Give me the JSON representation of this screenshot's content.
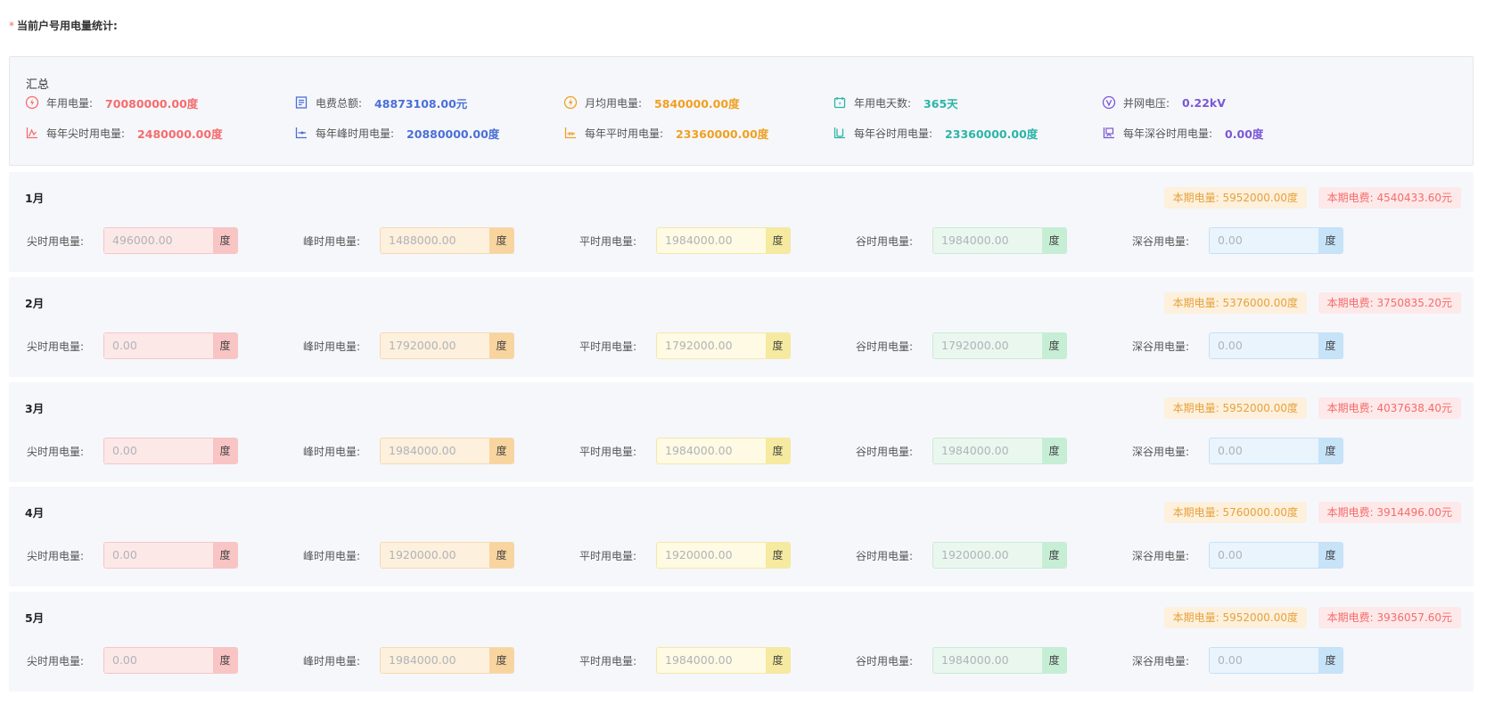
{
  "page_title": "当前户号用电量统计:",
  "required_mark": "*",
  "summary": {
    "title": "汇总",
    "stats": [
      {
        "label": "年用电量:",
        "value": "70080000.00度",
        "color": "#f56c6c",
        "icon": "power-icon"
      },
      {
        "label": "电费总额:",
        "value": "48873108.00元",
        "color": "#4a6fd8",
        "icon": "bill-icon"
      },
      {
        "label": "月均用电量:",
        "value": "5840000.00度",
        "color": "#f0a020",
        "icon": "lightning-icon"
      },
      {
        "label": "年用电天数:",
        "value": "365天",
        "color": "#2bb5a8",
        "icon": "calendar-icon"
      },
      {
        "label": "并网电压:",
        "value": "0.22kV",
        "color": "#7b57d6",
        "icon": "voltage-icon"
      },
      {
        "label": "每年尖时用电量:",
        "value": "2480000.00度",
        "color": "#f56c6c",
        "icon": "peak-chart-icon"
      },
      {
        "label": "每年峰时用电量:",
        "value": "20880000.00度",
        "color": "#4a6fd8",
        "icon": "high-chart-icon"
      },
      {
        "label": "每年平时用电量:",
        "value": "23360000.00度",
        "color": "#f0a020",
        "icon": "flat-chart-icon"
      },
      {
        "label": "每年谷时用电量:",
        "value": "23360000.00度",
        "color": "#2bb5a8",
        "icon": "valley-chart-icon"
      },
      {
        "label": "每年深谷时用电量:",
        "value": "0.00度",
        "color": "#7b57d6",
        "icon": "deep-valley-chart-icon"
      }
    ]
  },
  "field_labels": {
    "jian": "尖时用电量:",
    "feng": "峰时用电量:",
    "ping": "平时用电量:",
    "gu": "谷时用电量:",
    "shengu": "深谷用电量:"
  },
  "unit": "度",
  "months": [
    {
      "title": "1月",
      "usage": "本期电量: 5952000.00度",
      "fee": "本期电费: 4540433.60元",
      "jian": "496000.00",
      "feng": "1488000.00",
      "ping": "1984000.00",
      "gu": "1984000.00",
      "shengu": "0.00"
    },
    {
      "title": "2月",
      "usage": "本期电量: 5376000.00度",
      "fee": "本期电费: 3750835.20元",
      "jian": "0.00",
      "feng": "1792000.00",
      "ping": "1792000.00",
      "gu": "1792000.00",
      "shengu": "0.00"
    },
    {
      "title": "3月",
      "usage": "本期电量: 5952000.00度",
      "fee": "本期电费: 4037638.40元",
      "jian": "0.00",
      "feng": "1984000.00",
      "ping": "1984000.00",
      "gu": "1984000.00",
      "shengu": "0.00"
    },
    {
      "title": "4月",
      "usage": "本期电量: 5760000.00度",
      "fee": "本期电费: 3914496.00元",
      "jian": "0.00",
      "feng": "1920000.00",
      "ping": "1920000.00",
      "gu": "1920000.00",
      "shengu": "0.00"
    },
    {
      "title": "5月",
      "usage": "本期电量: 5952000.00度",
      "fee": "本期电费: 3936057.60元",
      "jian": "0.00",
      "feng": "1984000.00",
      "ping": "1984000.00",
      "gu": "1984000.00",
      "shengu": "0.00"
    }
  ]
}
